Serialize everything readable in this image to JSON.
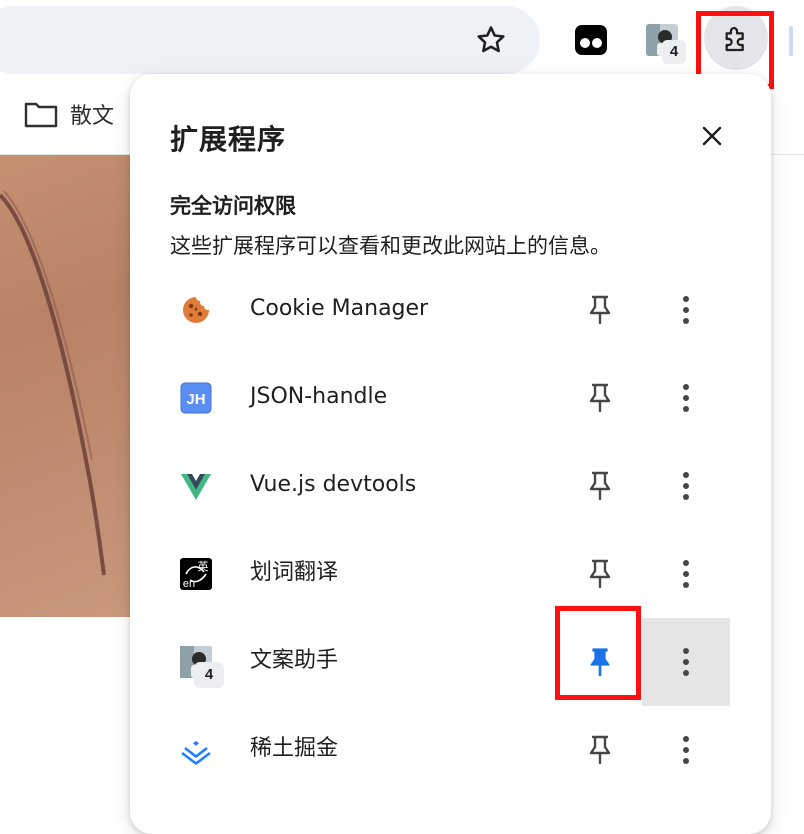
{
  "toolbar": {
    "extension_badge_count": "4"
  },
  "bookmarks_bar": {
    "items": [
      {
        "label": "散文"
      }
    ]
  },
  "popup": {
    "title": "扩展程序",
    "section": {
      "title": "完全访问权限",
      "description": "这些扩展程序可以查看和更改此网站上的信息。"
    },
    "extensions": [
      {
        "name": "Cookie Manager",
        "icon": "cookie-icon",
        "pinned": false
      },
      {
        "name": "JSON-handle",
        "icon": "jh-icon",
        "icon_text": "JH",
        "pinned": false
      },
      {
        "name": "Vue.js devtools",
        "icon": "vue-logo-icon",
        "pinned": false
      },
      {
        "name": "划词翻译",
        "icon": "translate-icon",
        "icon_text_top": "英",
        "icon_text_bottom": "en",
        "pinned": false
      },
      {
        "name": "文案助手",
        "icon": "avatar-icon",
        "badge": "4",
        "pinned": true
      },
      {
        "name": "稀土掘金",
        "icon": "juejin-icon",
        "pinned": false
      }
    ]
  },
  "colors": {
    "highlight_box": "#ff1010",
    "pinned_blue": "#1a73e8",
    "icon_gray": "#444746"
  }
}
